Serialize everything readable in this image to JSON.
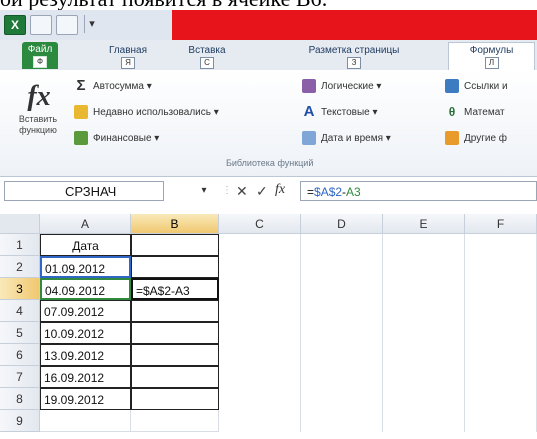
{
  "page": {
    "top_text": "ой результат появится в ячейке B6:"
  },
  "qat": {
    "app_icon_label": "X"
  },
  "tabs": [
    {
      "label": "Файл",
      "key": "Ф"
    },
    {
      "label": "Главная",
      "key": "Я"
    },
    {
      "label": "Вставка",
      "key": "С"
    },
    {
      "label": "Разметка страницы",
      "key": "З"
    },
    {
      "label": "Формулы",
      "key": "Л"
    }
  ],
  "ribbon": {
    "insert_function_icon": "fx",
    "insert_function_label": "Вставить функцию",
    "col1": [
      {
        "icon": "sigma-icon",
        "glyph": "Σ",
        "label": "Автосумма ▾"
      },
      {
        "icon": "recent-star-icon",
        "glyph": "",
        "label": "Недавно использовались ▾"
      },
      {
        "icon": "financial-book-icon",
        "glyph": "",
        "label": "Финансовые ▾"
      }
    ],
    "col2": [
      {
        "icon": "logical-icon",
        "glyph": "",
        "label": "Логические ▾"
      },
      {
        "icon": "text-a-icon",
        "glyph": "A",
        "label": "Текстовые ▾"
      },
      {
        "icon": "calendar-icon",
        "glyph": "",
        "label": "Дата и время ▾"
      }
    ],
    "col3": [
      {
        "icon": "lookup-link-icon",
        "glyph": "",
        "label": "Ссылки и"
      },
      {
        "icon": "math-icon",
        "glyph": "θ",
        "label": "Математ"
      },
      {
        "icon": "more-functions-icon",
        "glyph": "",
        "label": "Другие ф"
      }
    ],
    "group_label": "Библиотека функций"
  },
  "formula_bar": {
    "name_box": "СРЗНАЧ",
    "name_drop": "▾",
    "separator": "⋮",
    "cancel": "✕",
    "confirm": "✓",
    "fx": "fx",
    "formula_prefix": "=",
    "formula_ref1": "$A$2",
    "formula_op": "-",
    "formula_ref2": "A3"
  },
  "grid": {
    "columns": [
      "A",
      "B",
      "C",
      "D",
      "E",
      "F"
    ],
    "rows": [
      "1",
      "2",
      "3",
      "4",
      "5",
      "6",
      "7",
      "8",
      "9"
    ],
    "a_values": [
      "Дата",
      "01.09.2012",
      "04.09.2012",
      "07.09.2012",
      "10.09.2012",
      "13.09.2012",
      "16.09.2012",
      "19.09.2012"
    ],
    "b3_editing": "=$A$2-A3"
  }
}
